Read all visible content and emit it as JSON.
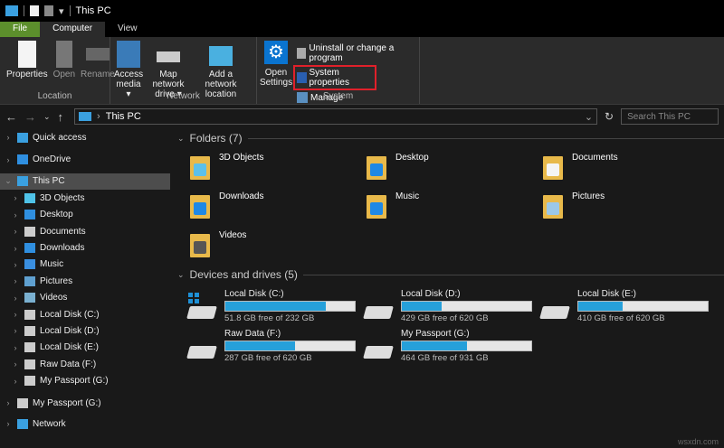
{
  "window": {
    "title": "This PC"
  },
  "tabs": [
    {
      "label": "File"
    },
    {
      "label": "Computer"
    },
    {
      "label": "View"
    }
  ],
  "ribbon": {
    "location": {
      "label": "Location",
      "buttons": [
        "Properties",
        "Open",
        "Rename"
      ]
    },
    "network": {
      "label": "Network",
      "access": "Access media ▾",
      "map": "Map network drive ▾",
      "add": "Add a network location"
    },
    "system": {
      "label": "System",
      "settings": "Open Settings",
      "uninstall": "Uninstall or change a program",
      "sysprops": "System properties",
      "manage": "Manage"
    }
  },
  "address": {
    "path": "This PC",
    "search_placeholder": "Search This PC"
  },
  "sidebar": [
    {
      "label": "Quick access",
      "level": 0
    },
    {
      "label": "OneDrive",
      "level": 0
    },
    {
      "label": "This PC",
      "level": 0,
      "selected": true
    },
    {
      "label": "3D Objects",
      "level": 1
    },
    {
      "label": "Desktop",
      "level": 1
    },
    {
      "label": "Documents",
      "level": 1
    },
    {
      "label": "Downloads",
      "level": 1
    },
    {
      "label": "Music",
      "level": 1
    },
    {
      "label": "Pictures",
      "level": 1
    },
    {
      "label": "Videos",
      "level": 1
    },
    {
      "label": "Local Disk (C:)",
      "level": 1
    },
    {
      "label": "Local Disk (D:)",
      "level": 1
    },
    {
      "label": "Local Disk (E:)",
      "level": 1
    },
    {
      "label": "Raw Data (F:)",
      "level": 1
    },
    {
      "label": "My Passport (G:)",
      "level": 1
    },
    {
      "label": "My Passport (G:)",
      "level": 0
    },
    {
      "label": "Network",
      "level": 0
    }
  ],
  "folders": {
    "title": "Folders (7)",
    "items": [
      "3D Objects",
      "Desktop",
      "Documents",
      "Downloads",
      "Music",
      "Pictures",
      "Videos"
    ]
  },
  "drives": {
    "title": "Devices and drives (5)",
    "items": [
      {
        "name": "Local Disk (C:)",
        "free": "51.8 GB free of 232 GB",
        "used": 0.777,
        "system": true
      },
      {
        "name": "Local Disk (D:)",
        "free": "429 GB free of 620 GB",
        "used": 0.31
      },
      {
        "name": "Local Disk (E:)",
        "free": "410 GB free of 620 GB",
        "used": 0.34
      },
      {
        "name": "Raw Data (F:)",
        "free": "287 GB free of 620 GB",
        "used": 0.537
      },
      {
        "name": "My Passport (G:)",
        "free": "464 GB free of 931 GB",
        "used": 0.502
      }
    ]
  },
  "watermark": "wsxdn.com"
}
